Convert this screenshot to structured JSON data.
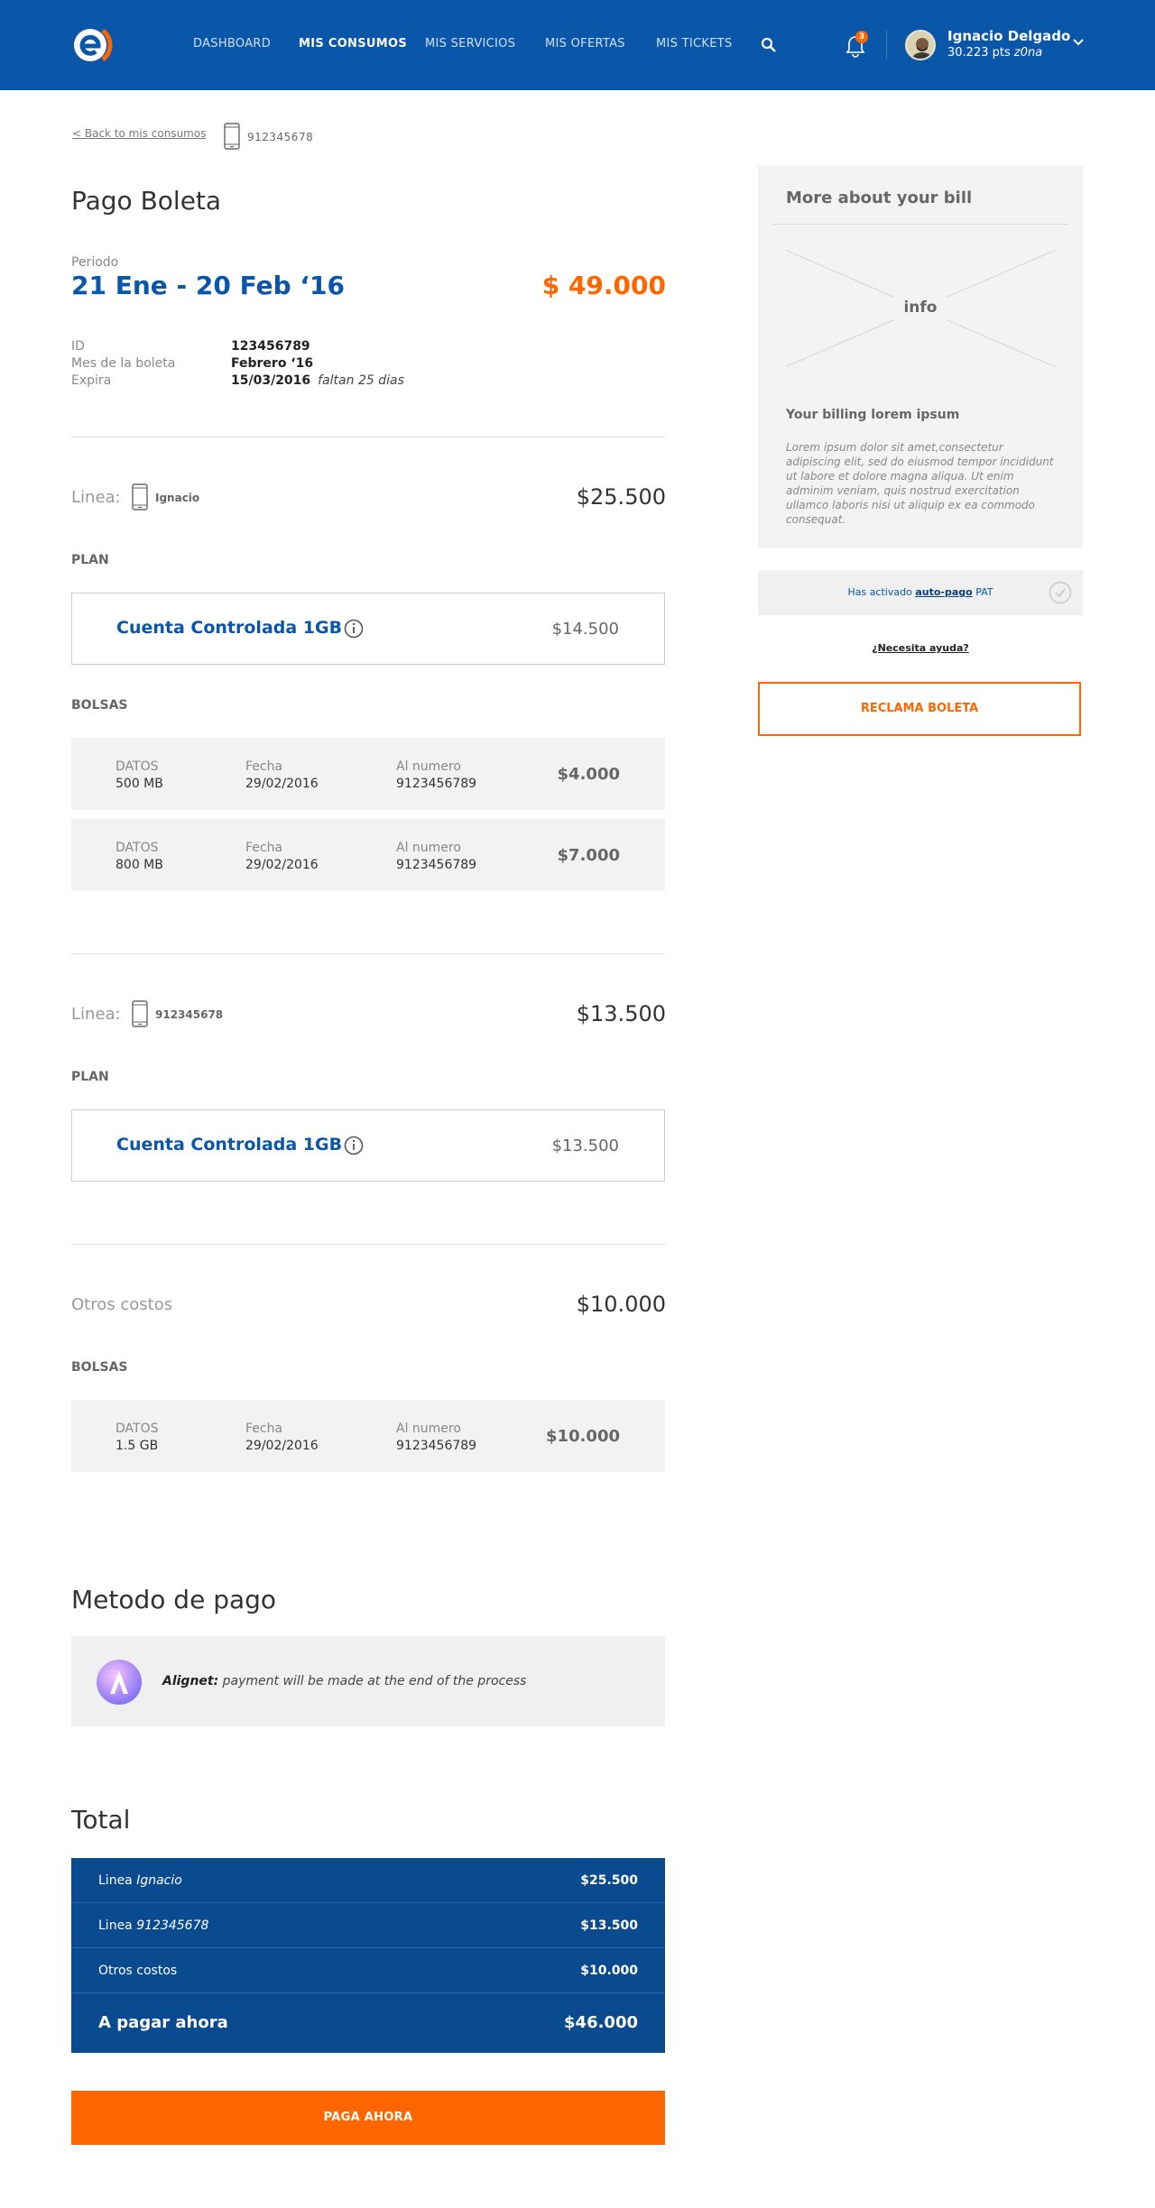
{
  "header": {
    "nav": [
      "DASHBOARD",
      "MIS CONSUMOS",
      "MIS SERVICIOS",
      "MIS OFERTAS",
      "MIS TICKETS"
    ],
    "notifications_count": "3",
    "user_name": "Ignacio Delgado",
    "user_pts": "30.223 pts",
    "user_tier": "z0na",
    "brand_color": "#0a56a8",
    "accent_color": "#ff6600"
  },
  "back": {
    "label": "< Back to mis consumos",
    "number": "912345678"
  },
  "bill": {
    "title": "Pago Boleta",
    "periodo_label": "Periodo",
    "periodo": "21 Ene - 20 Feb ‘16",
    "amount": "$ 49.000",
    "id_label": "ID",
    "id_value": "123456789",
    "mes_label": "Mes de la boleta",
    "mes_value": "Febrero ‘16",
    "expira_label": "Expira",
    "expira_value": "15/03/2016",
    "expira_note": "faltan 25 dias"
  },
  "line1": {
    "label": "Linea:",
    "name": "Ignacio",
    "total": "$25.500",
    "plan_label": "PLAN",
    "plan_name": "Cuenta Controlada 1GB",
    "plan_price": "$14.500",
    "bolsas_label": "BOLSAS",
    "bolsas": [
      {
        "type_label": "DATOS",
        "type_value": "500 MB",
        "fecha_label": "Fecha",
        "fecha_value": "29/02/2016",
        "num_label": "Al numero",
        "num_value": "9123456789",
        "price": "$4.000"
      },
      {
        "type_label": "DATOS",
        "type_value": "800 MB",
        "fecha_label": "Fecha",
        "fecha_value": "29/02/2016",
        "num_label": "Al numero",
        "num_value": "9123456789",
        "price": "$7.000"
      }
    ]
  },
  "line2": {
    "label": "Linea:",
    "name": "912345678",
    "total": "$13.500",
    "plan_label": "PLAN",
    "plan_name": "Cuenta Controlada 1GB",
    "plan_price": "$13.500"
  },
  "otros": {
    "label": "Otros costos",
    "total": "$10.000",
    "bolsas_label": "BOLSAS",
    "bolsas": [
      {
        "type_label": "DATOS",
        "type_value": "1.5 GB",
        "fecha_label": "Fecha",
        "fecha_value": "29/02/2016",
        "num_label": "Al numero",
        "num_value": "9123456789",
        "price": "$10.000"
      }
    ]
  },
  "payment": {
    "title": "Metodo de pago",
    "provider": "Alignet:",
    "text": "payment will be made at the end of the process"
  },
  "totals": {
    "title": "Total",
    "rows": [
      {
        "prefix": "Linea",
        "name": "Ignacio",
        "amount": "$25.500"
      },
      {
        "prefix": "Linea",
        "name": "912345678",
        "amount": "$13.500"
      },
      {
        "prefix": "Otros costos",
        "name": "",
        "amount": "$10.000"
      }
    ],
    "final_label": "A pagar ahora",
    "final_amount": "$46.000",
    "pay_button": "PAGA AHORA"
  },
  "sidebar": {
    "title": "More about your bill",
    "image_label": "info",
    "subtitle": "Your billing lorem ipsum",
    "body": "Lorem ipsum dolor sit amet,consectetur adipiscing elit, sed do eiusmod tempor incididunt ut labore et dolore magna aliqua. Ut enim adminim veniam, quis nostrud exercitation ullamco laboris nisi ut aliquip ex ea commodo consequat.",
    "pat_prefix": "Has activado",
    "pat_link": "auto-pago",
    "pat_suffix": "PAT",
    "help": "¿Necesita ayuda?",
    "reclama": "RECLAMA BOLETA"
  }
}
